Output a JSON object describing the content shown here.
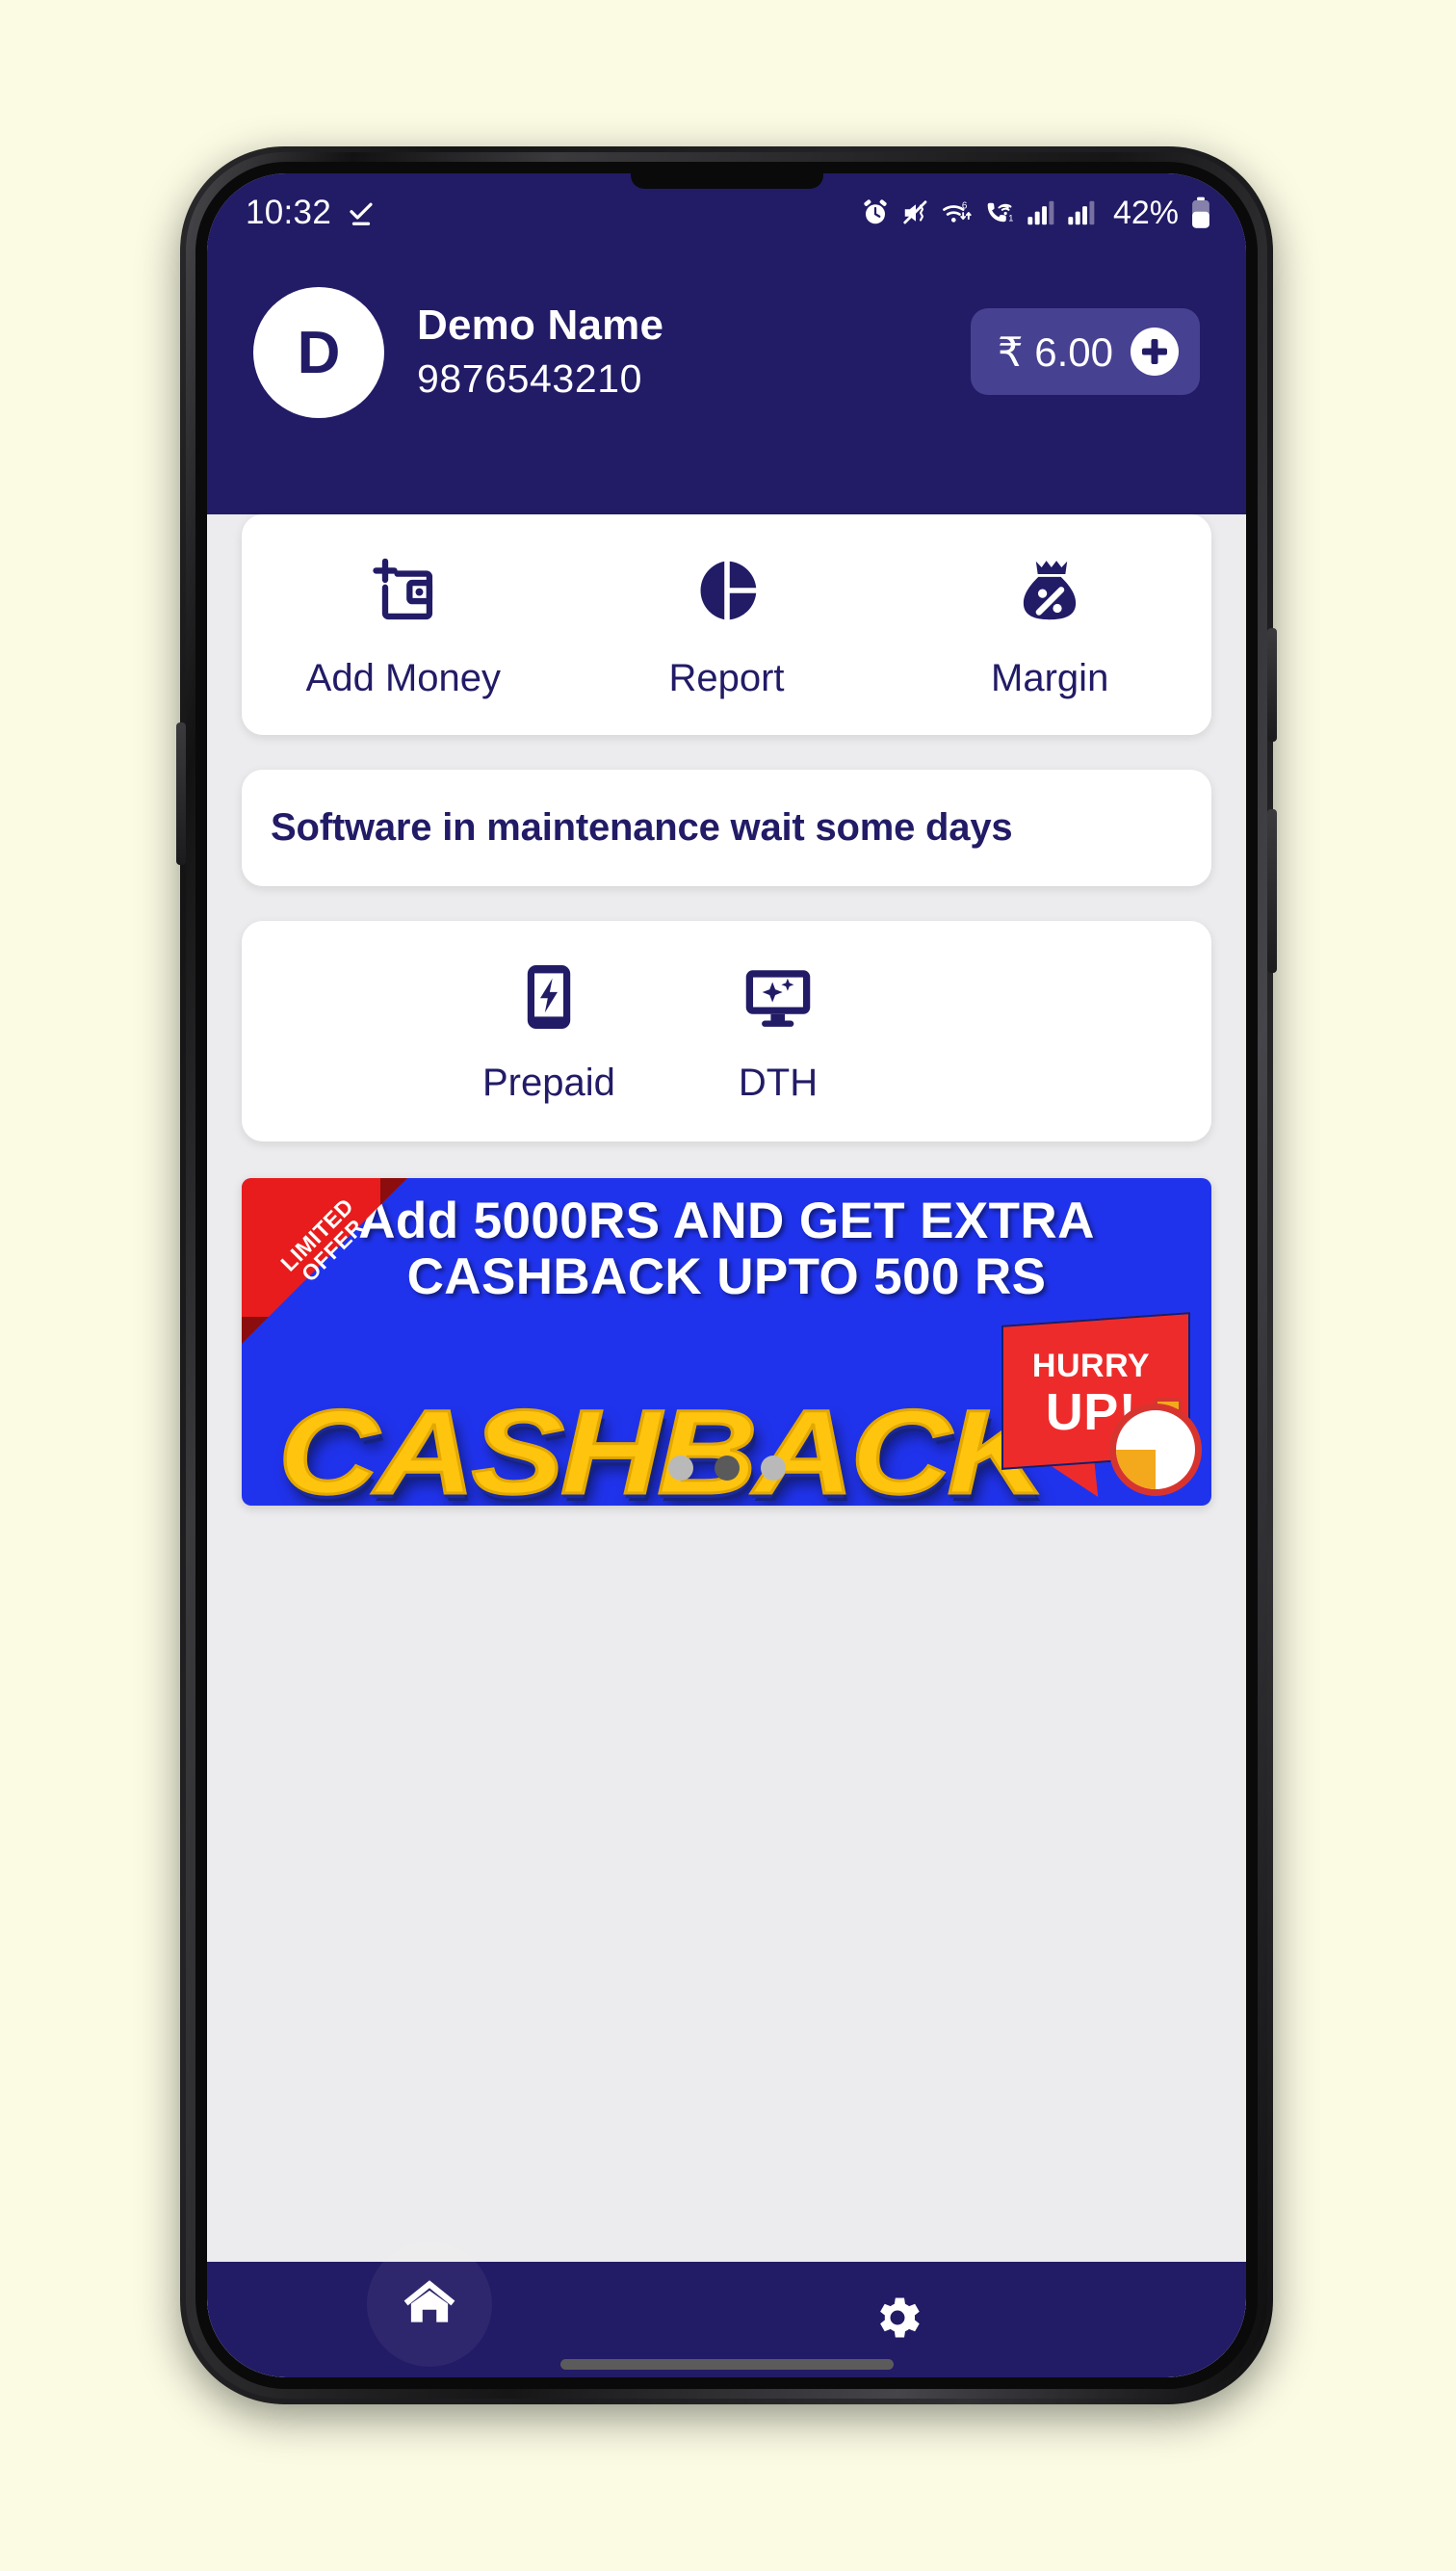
{
  "status_bar": {
    "time": "10:32",
    "battery_percent": "42%",
    "icons": [
      "check-done-icon",
      "alarm-icon",
      "mute-vibrate-icon",
      "wifi-6-icon",
      "vowifi-call-icon",
      "signal-bars-sim1-icon",
      "signal-bars-sim2-icon",
      "battery-icon"
    ]
  },
  "header": {
    "avatar_initial": "D",
    "user_name": "Demo Name",
    "user_phone": "9876543210",
    "balance": "₹ 6.00",
    "add_money_icon": "plus-icon",
    "bg_color": "#221B66",
    "chip_color": "#474191"
  },
  "quick_actions": [
    {
      "label": "Add Money",
      "icon": "wallet-plus-icon"
    },
    {
      "label": "Report",
      "icon": "pie-chart-icon"
    },
    {
      "label": "Margin",
      "icon": "money-bag-percent-icon"
    }
  ],
  "notice": {
    "text": "Software in maintenance wait some days"
  },
  "services": [
    {
      "label": "Prepaid",
      "icon": "mobile-recharge-icon"
    },
    {
      "label": "DTH",
      "icon": "tv-dth-icon"
    }
  ],
  "banner": {
    "ribbon_line1": "LIMITED",
    "ribbon_line2": "OFFER",
    "headline": "Add 5000RS AND GET EXTRA CASHBACK UPTO 500 RS",
    "cashback_word": "CASHBACK",
    "hurry_line1": "HURRY",
    "hurry_line2": "UP!",
    "bg_color": "#2033EC",
    "ribbon_color": "#E81C1C",
    "cashback_color": "#FFC40D",
    "dots": [
      {
        "active": false
      },
      {
        "active": true
      },
      {
        "active": false
      }
    ]
  },
  "bottom_nav": [
    {
      "name": "home",
      "icon": "home-icon",
      "active": true
    },
    {
      "name": "settings",
      "icon": "gear-icon",
      "active": false
    }
  ]
}
